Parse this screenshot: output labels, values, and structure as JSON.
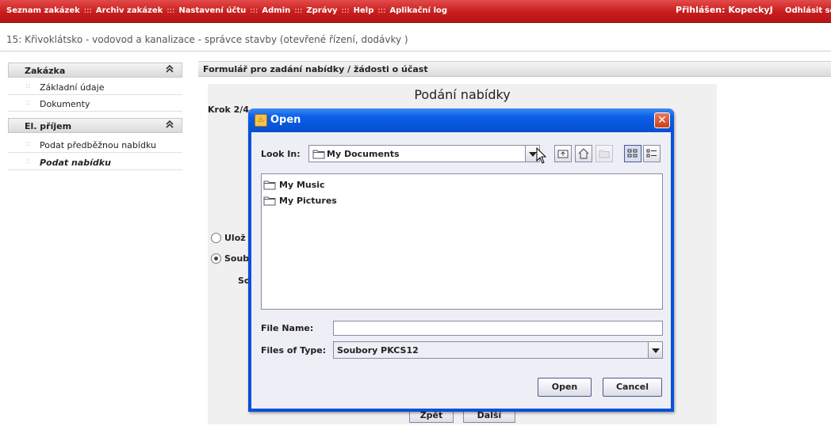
{
  "nav": {
    "items": [
      "Seznam zakázek",
      "Archiv zakázek",
      "Nastavení účtu",
      "Admin",
      "Zprávy",
      "Help",
      "Aplikační log"
    ],
    "separator": ":::",
    "user": "Přihlášen: KopeckyJ",
    "logout": "Odhlásit se"
  },
  "breadcrumb": "15: Křivoklátsko - vodovod a kanalizace - správce stavby (otevřené řízení, dodávky )",
  "sidebar": {
    "section1": {
      "title": "Zakázka",
      "collapse_icon": "double-chevron-up-icon",
      "items": [
        {
          "label": "Základní údaje"
        },
        {
          "label": "Dokumenty"
        }
      ]
    },
    "section2": {
      "title": "El. příjem",
      "collapse_icon": "double-chevron-up-icon",
      "items": [
        {
          "label": "Podat předběžnou nabídku"
        },
        {
          "label": "Podat nabídku",
          "active": true
        }
      ]
    },
    "bullet": "::",
    "collapse_glyph": "≈"
  },
  "form": {
    "header": "Formulář pro zadání nabídky / žádosti o účast",
    "title": "Podání nabídky",
    "step": "Krok 2/4",
    "radio1_label": "Ulož",
    "radio2_label": "Soub",
    "sub_label": "So",
    "button_left": "Zpět",
    "button_right": "Další"
  },
  "dialog": {
    "title": "Open",
    "look_in_label": "Look In:",
    "look_in_value": "My Documents",
    "files": [
      {
        "name": "My Music",
        "icon": "folder-icon"
      },
      {
        "name": "My Pictures",
        "icon": "folder-icon"
      }
    ],
    "file_name_label": "File Name:",
    "file_name_value": "",
    "files_of_type_label": "Files of Type:",
    "files_of_type_value": "Soubory PKCS12",
    "open_button": "Open",
    "cancel_button": "Cancel",
    "close_glyph": "✕",
    "toolbar_icons": [
      "up-folder-icon",
      "home-icon",
      "new-folder-icon",
      "list-view-icon",
      "details-view-icon"
    ]
  },
  "colors": {
    "nav_red": "#c81d1d",
    "dialog_blue": "#0a4fdb",
    "dialog_body": "#eeeef6"
  }
}
